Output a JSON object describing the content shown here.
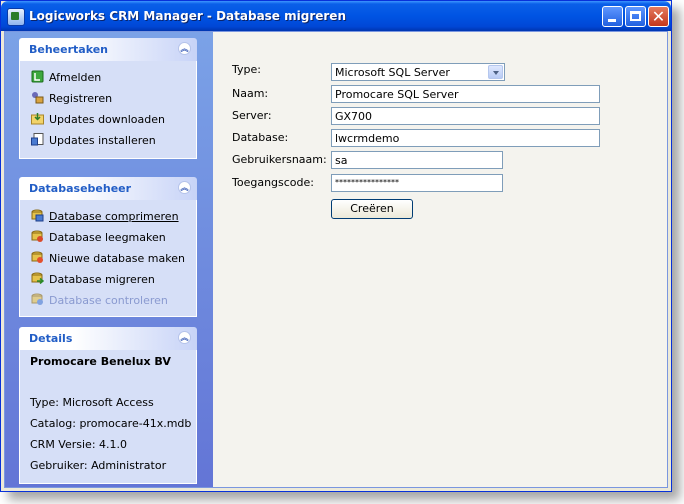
{
  "window": {
    "title": "Logicworks CRM Manager - Database migreren"
  },
  "sidebar": {
    "beheertaken": {
      "title": "Beheertaken",
      "items": [
        {
          "label": "Afmelden",
          "icon": "logout-icon"
        },
        {
          "label": "Registreren",
          "icon": "register-icon"
        },
        {
          "label": "Updates downloaden",
          "icon": "download-icon"
        },
        {
          "label": "Updates installeren",
          "icon": "install-icon"
        }
      ]
    },
    "databasebeheer": {
      "title": "Databasebeheer",
      "items": [
        {
          "label": "Database comprimeren",
          "icon": "compress-icon"
        },
        {
          "label": "Database leegmaken",
          "icon": "empty-db-icon"
        },
        {
          "label": "Nieuwe database maken",
          "icon": "new-db-icon"
        },
        {
          "label": "Database migreren",
          "icon": "migrate-icon"
        },
        {
          "label": "Database controleren",
          "icon": "check-db-icon"
        }
      ]
    },
    "details": {
      "title": "Details",
      "company": "Promocare Benelux BV",
      "type": "Type: Microsoft Access",
      "catalog": "Catalog: promocare-41x.mdb",
      "version": "CRM Versie: 4.1.0",
      "user": "Gebruiker: Administrator"
    }
  },
  "form": {
    "type_label": "Type:",
    "type_value": "Microsoft SQL Server",
    "name_label": "Naam:",
    "name_value": "Promocare SQL Server",
    "server_label": "Server:",
    "server_value": "GX700",
    "database_label": "Database:",
    "database_value": "lwcrmdemo",
    "user_label": "Gebruikersnaam:",
    "user_value": "sa",
    "password_label": "Toegangscode:",
    "password_value": "****************",
    "create_button": "Creëren"
  }
}
